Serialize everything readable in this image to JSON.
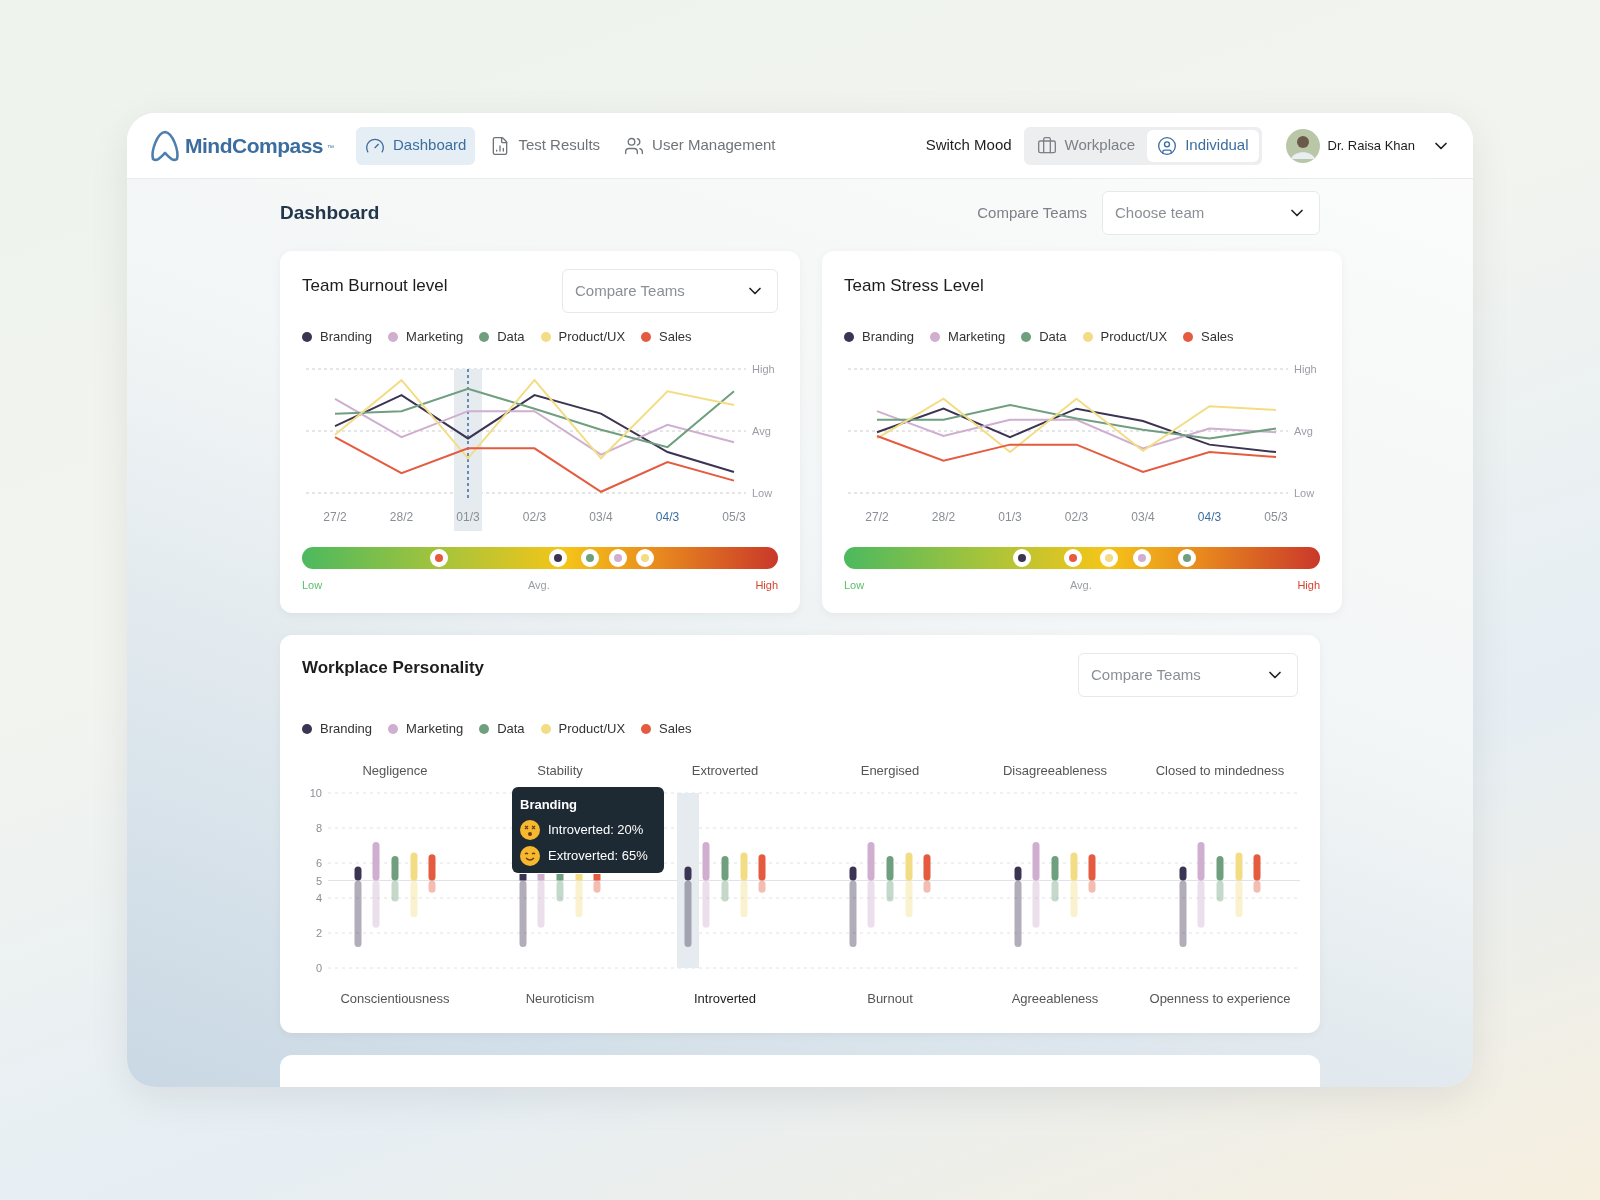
{
  "header": {
    "logo": {
      "name": "MindCompass",
      "mark": "™"
    },
    "nav": [
      {
        "label": "Dashboard",
        "selected": true
      },
      {
        "label": "Test Results",
        "selected": false
      },
      {
        "label": "User Management",
        "selected": false
      }
    ],
    "mood_label": "Switch Mood",
    "mood_options": [
      {
        "label": "Workplace",
        "selected": false
      },
      {
        "label": "Individual",
        "selected": true
      }
    ],
    "user": {
      "name": "Dr. Raisa Khan"
    }
  },
  "page": {
    "title": "Dashboard",
    "compare_label": "Compare Teams",
    "team_select": {
      "placeholder": "Choose team"
    }
  },
  "cards": [
    {
      "title": "Team Burnout level",
      "select": {
        "placeholder": "Compare Teams"
      },
      "legend": [
        {
          "label": "Branding",
          "color": "#3b3452"
        },
        {
          "label": "Marketing",
          "color": "#cfaed0"
        },
        {
          "label": "Data",
          "color": "#6f9f7e"
        },
        {
          "label": "Product/UX",
          "color": "#f2dd85"
        },
        {
          "label": "Sales",
          "color": "#e45b3f"
        }
      ],
      "y_labels": [
        "High",
        "Avg",
        "Low"
      ],
      "x_labels": [
        {
          "label": "27/2",
          "hovered": false,
          "selected": false
        },
        {
          "label": "28/2",
          "hovered": false,
          "selected": false
        },
        {
          "label": "01/3",
          "hovered": true,
          "selected": false
        },
        {
          "label": "02/3",
          "hovered": false,
          "selected": false
        },
        {
          "label": "03/4",
          "hovered": false,
          "selected": false
        },
        {
          "label": "04/3",
          "hovered": false,
          "selected": true
        },
        {
          "label": "05/3",
          "hovered": false,
          "selected": false
        }
      ],
      "meter": {
        "labels": [
          "Low",
          "Avg.",
          "High"
        ],
        "markers": [
          {
            "color": "#e45b3f"
          },
          {
            "color": "#3b3452"
          },
          {
            "color": "#6f9f7e"
          },
          {
            "color": "#cfaed0"
          },
          {
            "color": "#f2dd85"
          }
        ]
      }
    },
    {
      "title": "Team Stress Level",
      "legend": [
        {
          "label": "Branding",
          "color": "#3b3452"
        },
        {
          "label": "Marketing",
          "color": "#cfaed0"
        },
        {
          "label": "Data",
          "color": "#6f9f7e"
        },
        {
          "label": "Product/UX",
          "color": "#f2dd85"
        },
        {
          "label": "Sales",
          "color": "#e45b3f"
        }
      ],
      "y_labels": [
        "High",
        "Avg",
        "Low"
      ],
      "x_labels": [
        {
          "label": "27/2",
          "hovered": false,
          "selected": false
        },
        {
          "label": "28/2",
          "hovered": false,
          "selected": false
        },
        {
          "label": "01/3",
          "hovered": false,
          "selected": false
        },
        {
          "label": "02/3",
          "hovered": false,
          "selected": false
        },
        {
          "label": "03/4",
          "hovered": false,
          "selected": false
        },
        {
          "label": "04/3",
          "hovered": false,
          "selected": true
        },
        {
          "label": "05/3",
          "hovered": false,
          "selected": false
        }
      ],
      "meter": {
        "labels": [
          "Low",
          "Avg.",
          "High"
        ],
        "markers": [
          {
            "color": "#3b3452"
          },
          {
            "color": "#e45b3f"
          },
          {
            "color": "#f2dd85"
          },
          {
            "color": "#cfaed0"
          },
          {
            "color": "#6f9f7e"
          }
        ]
      }
    }
  ],
  "personality": {
    "title": "Workplace Personality",
    "select": {
      "placeholder": "Compare Teams"
    },
    "legend": [
      {
        "label": "Branding",
        "color": "#3b3452"
      },
      {
        "label": "Marketing",
        "color": "#cfaed0"
      },
      {
        "label": "Data",
        "color": "#6f9f7e"
      },
      {
        "label": "Product/UX",
        "color": "#f2dd85"
      },
      {
        "label": "Sales",
        "color": "#e45b3f"
      }
    ],
    "top_labels": [
      "Negligence",
      "Stability",
      "Extroverted",
      "Energised",
      "Disagreeableness",
      "Closed to mindedness"
    ],
    "y_labels": [
      "10",
      "8",
      "6",
      "5",
      "4",
      "2",
      "0"
    ],
    "bottom_labels": [
      {
        "label": "Conscientiousness",
        "hovered": false
      },
      {
        "label": "Neuroticism",
        "hovered": false
      },
      {
        "label": "Introverted",
        "hovered": true
      },
      {
        "label": "Burnout",
        "hovered": false
      },
      {
        "label": "Agreeableness",
        "hovered": false
      },
      {
        "label": "Openness to experience",
        "hovered": false
      }
    ],
    "tooltip": {
      "title": "Branding",
      "lines": [
        {
          "kind": "dizzy",
          "text": "Introverted: 20%"
        },
        {
          "kind": "smiling",
          "text": "Extroverted: 65%"
        }
      ]
    }
  }
}
